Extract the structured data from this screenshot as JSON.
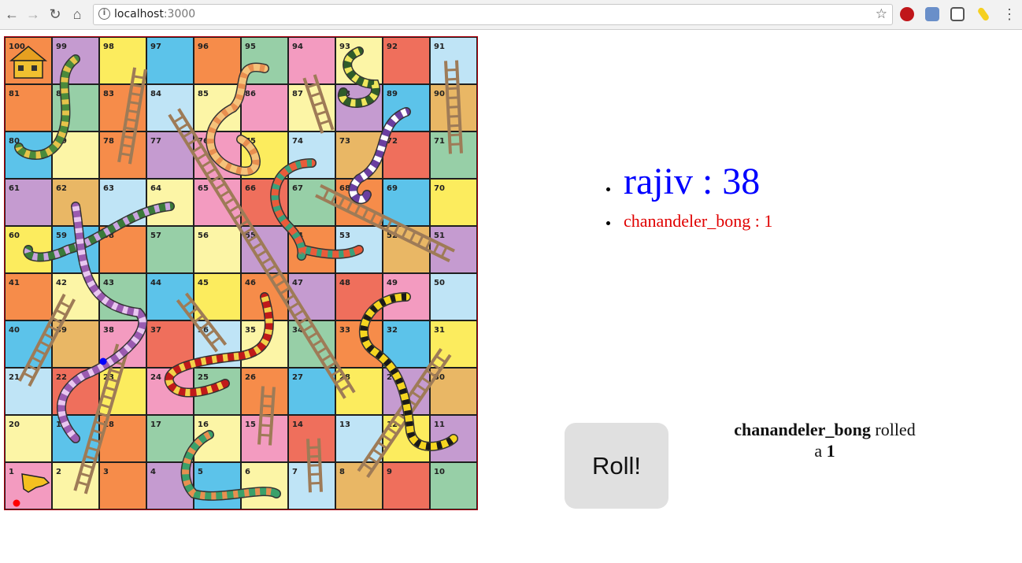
{
  "browser": {
    "url_host": "localhost",
    "url_port": ":3000"
  },
  "board": {
    "squares": [
      100,
      99,
      98,
      97,
      96,
      95,
      94,
      93,
      92,
      91,
      81,
      82,
      83,
      84,
      85,
      86,
      87,
      88,
      89,
      90,
      80,
      79,
      78,
      77,
      76,
      75,
      74,
      73,
      72,
      71,
      61,
      62,
      63,
      64,
      65,
      66,
      67,
      68,
      69,
      70,
      60,
      59,
      58,
      57,
      56,
      55,
      54,
      53,
      52,
      51,
      41,
      42,
      43,
      44,
      45,
      46,
      47,
      48,
      49,
      50,
      40,
      39,
      38,
      37,
      36,
      35,
      34,
      33,
      32,
      31,
      21,
      22,
      23,
      24,
      25,
      26,
      27,
      28,
      29,
      30,
      20,
      19,
      18,
      17,
      16,
      15,
      14,
      13,
      12,
      11,
      1,
      2,
      3,
      4,
      5,
      6,
      7,
      8,
      9,
      10
    ],
    "colors": {
      "orange": "#f68c4a",
      "purple": "#c59bd0",
      "yellow": "#fcec5e",
      "blue": "#5cc3ea",
      "lightblue": "#bfe4f6",
      "green": "#97cfa7",
      "pink": "#f39bc0",
      "cream": "#fcf5a6",
      "red": "#ef6f5c",
      "tan": "#e9b765",
      "ladder": "#9e7b57"
    },
    "player_tokens": [
      {
        "player": "rajiv",
        "square": 38,
        "color": "#0000ff"
      },
      {
        "player": "chanandeler_bong",
        "square": 1,
        "color": "#ff0000"
      }
    ]
  },
  "scoreboard": {
    "players": [
      {
        "name": "rajiv",
        "position": 38,
        "color": "#0000ff",
        "text": "rajiv : 38"
      },
      {
        "name": "chanandeler_bong",
        "position": 1,
        "color": "#e00000",
        "text": "chanandeler_bong : 1"
      }
    ]
  },
  "controls": {
    "roll_label": "Roll!"
  },
  "last_roll": {
    "player": "chanandeler_bong",
    "verb": " rolled",
    "article": "a ",
    "value": "1"
  }
}
